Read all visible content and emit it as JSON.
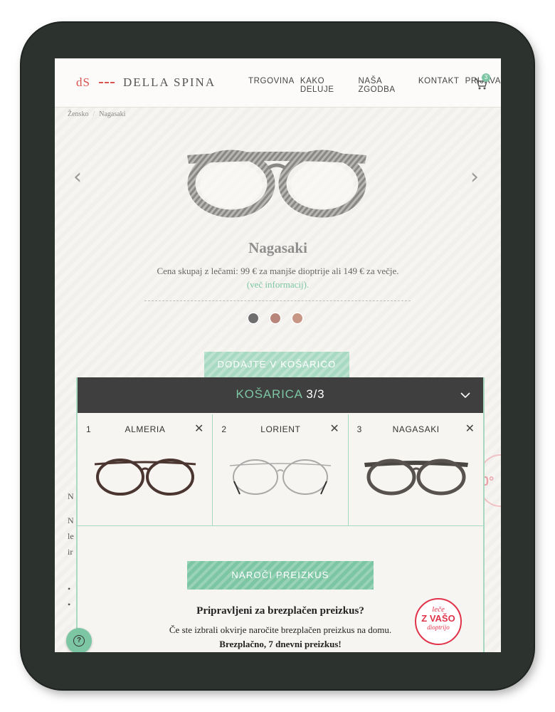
{
  "header": {
    "logo_mark": "dS",
    "logo_text": "DELLA SPINA",
    "nav": [
      "TRGOVINA",
      "KAKO DELUJE",
      "NAŠA ZGODBA",
      "KONTAKT",
      "PRIJAVA"
    ],
    "cart_count": "3"
  },
  "breadcrumb": {
    "parent": "Žensko",
    "current": "Nagasaki"
  },
  "product": {
    "title": "Nagasaki",
    "price_text": "Cena skupaj z lečami: 99 € za manjše dioptrije ali 149 € za večje.",
    "more_link": "(več informacij).",
    "add_to_cart": "DODAJTE V KOŠARICO",
    "swatch_colors": [
      "#6e6e6e",
      "#b8857a",
      "#c79684"
    ]
  },
  "background_fragments": [
    "N",
    "N",
    "le",
    "ir",
    "•",
    "•"
  ],
  "cart_panel": {
    "title": "KOŠARICA",
    "count": "3/3",
    "items": [
      {
        "num": "1",
        "name": "ALMERIA"
      },
      {
        "num": "2",
        "name": "LORIENT"
      },
      {
        "num": "3",
        "name": "NAGASAKI"
      }
    ],
    "order_button": "NAROČI PREIZKUS",
    "ready_heading": "Pripravljeni za brezplačen preizkus?",
    "description": "Če ste izbrali okvirje naročite brezplačen preizkus na domu.",
    "description_bold": "Brezplačno, 7 dnevni preizkus!",
    "stamp": {
      "line1": "leče",
      "line2": "Z VAŠO",
      "line3": "dioptrijo"
    }
  },
  "help_label": "?",
  "colors": {
    "accent": "#7cc6a3",
    "dark_bar": "#3f3f3f",
    "brand_red": "#d9534f",
    "device": "#2c332e"
  }
}
